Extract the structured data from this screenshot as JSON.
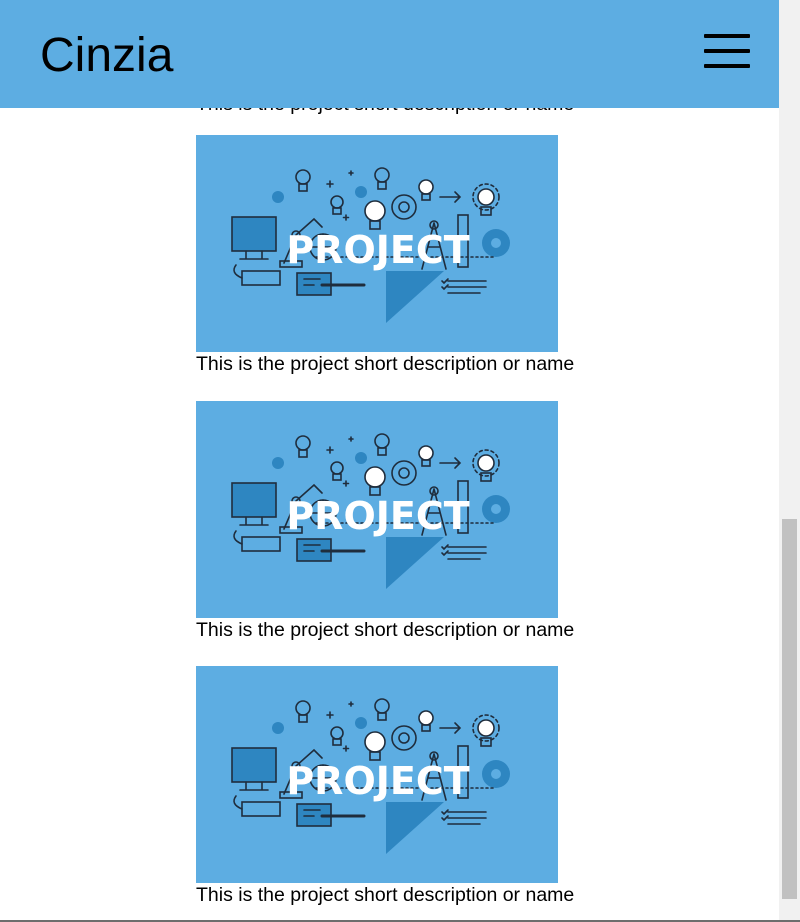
{
  "header": {
    "brand": "Cinzia",
    "menu_icon": "hamburger-menu-icon",
    "background_color": "#5dade2"
  },
  "projects": [
    {
      "caption": "This is the project short description or name",
      "image_word": "PROJECT"
    },
    {
      "caption": "This is the project short description or name",
      "image_word": "PROJECT"
    },
    {
      "caption": "This is the project short description or name",
      "image_word": "PROJECT"
    },
    {
      "caption": "This is the project short description or name",
      "image_word": "PROJECT"
    }
  ]
}
